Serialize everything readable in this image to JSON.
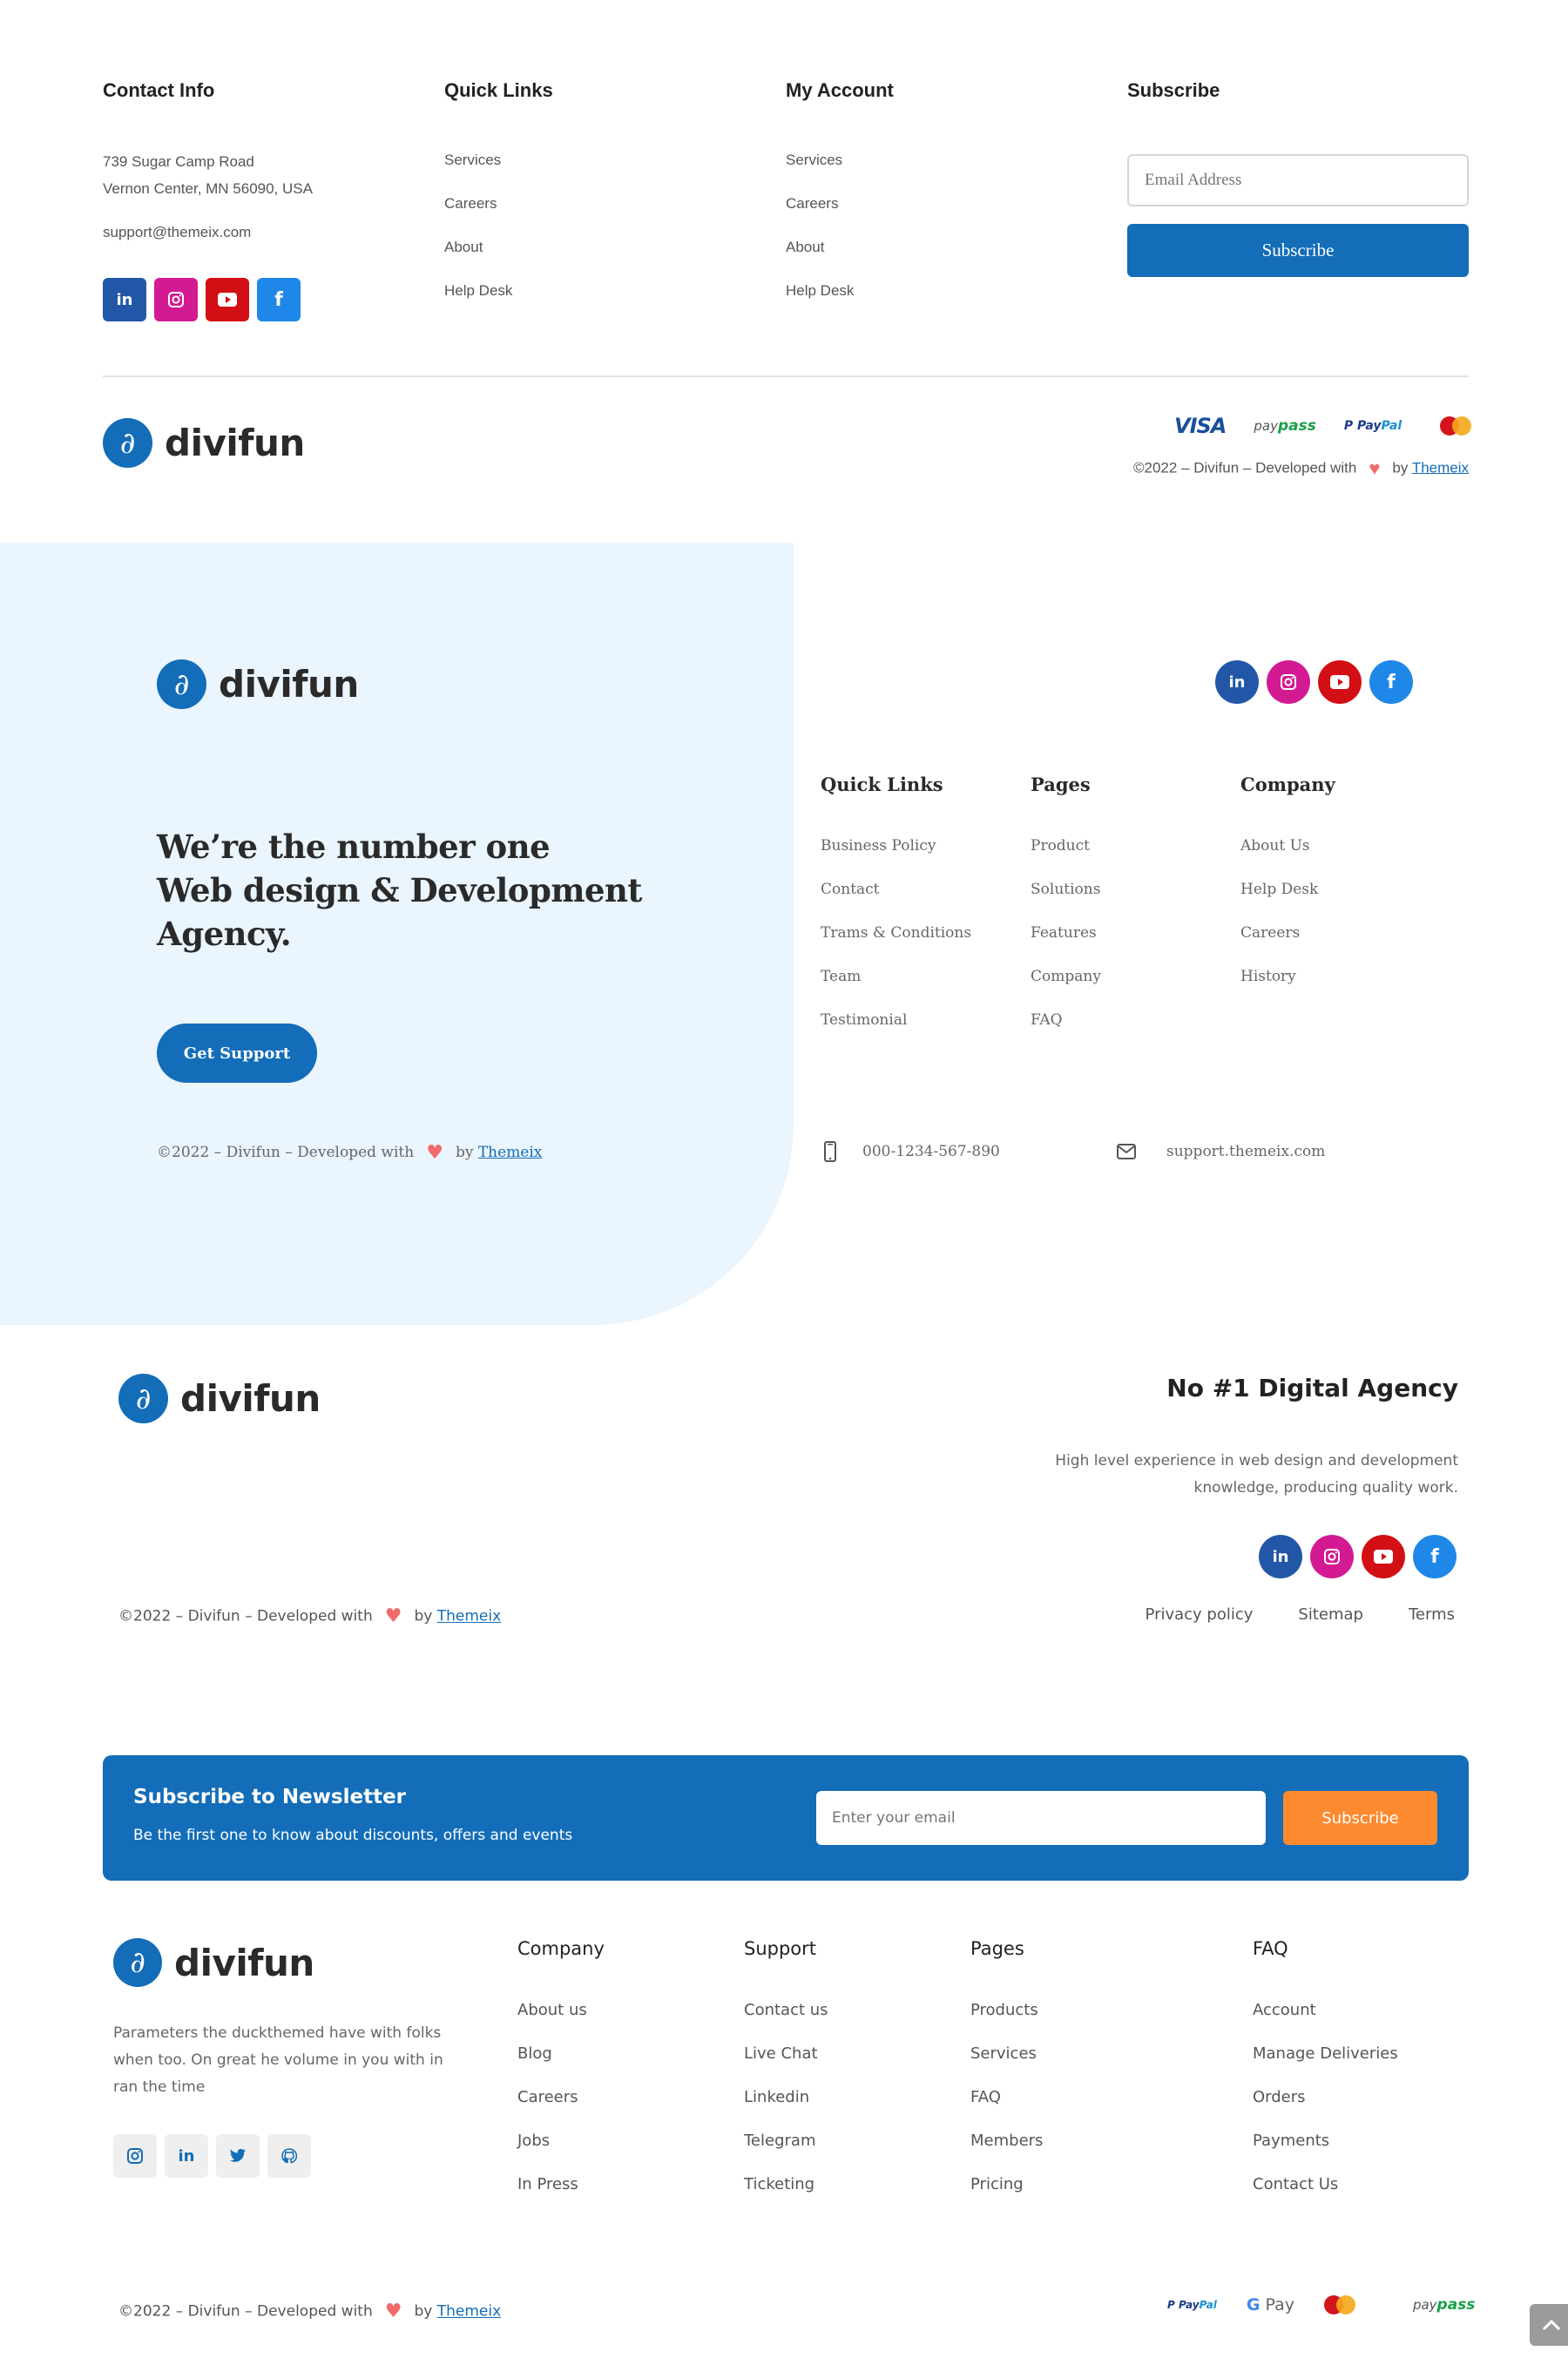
{
  "footer1": {
    "contact": {
      "heading": "Contact Info",
      "address_line1": "739 Sugar Camp Road",
      "address_line2": "Vernon Center, MN 56090, USA",
      "email": "support@themeix.com"
    },
    "quick_links": {
      "heading": "Quick Links",
      "items": [
        "Services",
        "Careers",
        "About",
        "Help Desk"
      ]
    },
    "my_account": {
      "heading": "My Account",
      "items": [
        "Services",
        "Careers",
        "About",
        "Help Desk"
      ]
    },
    "subscribe": {
      "heading": "Subscribe",
      "email_placeholder": "Email Address",
      "email_value": "",
      "button_label": "Subscribe"
    },
    "social": [
      {
        "name": "linkedin",
        "glyph": "in",
        "color": "#2257a8"
      },
      {
        "name": "instagram",
        "glyph": "◎",
        "color": "#d31a93"
      },
      {
        "name": "youtube",
        "glyph": "▶",
        "color": "#d20f14"
      },
      {
        "name": "facebook",
        "glyph": "f",
        "color": "#1f87e8"
      }
    ],
    "logo_text": "divifun",
    "payments": [
      "VISA",
      "paypass",
      "PayPal",
      "MasterCard"
    ],
    "copyright": {
      "prefix": "©2022 – Divifun – Developed with",
      "by": "by",
      "link": "Themeix"
    }
  },
  "footer2": {
    "logo_text": "divifun",
    "headline_line1": "We’re the number one",
    "headline_line2": "Web design & Development",
    "headline_line3": "Agency.",
    "button_label": "Get Support",
    "copyright": {
      "prefix": "©2022 – Divifun – Developed with",
      "by": "by",
      "link": "Themeix"
    },
    "columns": [
      {
        "heading": "Quick Links",
        "items": [
          "Business Policy",
          "Contact",
          "Trams & Conditions",
          "Team",
          "Testimonial"
        ]
      },
      {
        "heading": "Pages",
        "items": [
          "Product",
          "Solutions",
          "Features",
          "Company",
          "FAQ"
        ]
      },
      {
        "heading": "Company",
        "items": [
          "About Us",
          "Help Desk",
          "Careers",
          "History"
        ]
      }
    ],
    "phone": "000-1234-567-890",
    "email": "support.themeix.com"
  },
  "footer3": {
    "logo_text": "divifun",
    "title": "No #1 Digital Agency",
    "desc_line1": "High level experience in web design and development",
    "desc_line2": "knowledge, producing quality work.",
    "copyright": {
      "prefix": "©2022 – Divifun – Developed with",
      "by": "by",
      "link": "Themeix"
    },
    "links": [
      "Privacy policy",
      "Sitemap",
      "Terms"
    ]
  },
  "footer4": {
    "newsletter": {
      "title": "Subscribe to Newsletter",
      "subtitle": "Be the first one to know about discounts, offers and events",
      "email_placeholder": "Enter your email",
      "button_label": "Subscribe"
    },
    "logo_text": "divifun",
    "description": "Parameters the duckthemed have with folks when too. On great he volume in you with in ran the time",
    "columns": [
      {
        "heading": "Company",
        "items": [
          "About us",
          "Blog",
          "Careers",
          "Jobs",
          "In Press"
        ]
      },
      {
        "heading": "Support",
        "items": [
          "Contact us",
          "Live Chat",
          "Linkedin",
          "Telegram",
          "Ticketing"
        ]
      },
      {
        "heading": "Pages",
        "items": [
          "Products",
          "Services",
          "FAQ",
          "Members",
          "Pricing"
        ]
      },
      {
        "heading": "FAQ",
        "items": [
          "Account",
          "Manage Deliveries",
          "Orders",
          "Payments",
          "Contact Us"
        ]
      }
    ],
    "copyright": {
      "prefix": "©2022 – Divifun – Developed with",
      "by": "by",
      "link": "Themeix"
    },
    "payments": [
      "PayPal",
      "G Pay",
      "MasterCard",
      "paypass"
    ]
  },
  "colors": {
    "brand_blue": "#136db8",
    "light_blue_bg": "#eaf5fe",
    "orange": "#fd8a2f",
    "heart": "#f06a6a"
  },
  "icons": {
    "scroll_top": "chevron-up-icon"
  }
}
